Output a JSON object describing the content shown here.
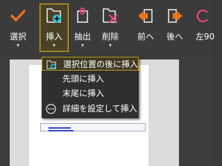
{
  "toolbar": {
    "items": [
      {
        "label": "選択",
        "icon": "checkmark-icon",
        "dropdown": true
      },
      {
        "label": "挿入",
        "icon": "insert-page-icon",
        "dropdown": true
      },
      {
        "label": "抽出",
        "icon": "extract-icon",
        "dropdown": true
      },
      {
        "label": "削除",
        "icon": "delete-page-icon",
        "dropdown": true
      },
      {
        "label": "前へ",
        "icon": "arrow-left-icon",
        "dropdown": false
      },
      {
        "label": "後へ",
        "icon": "arrow-right-icon",
        "dropdown": false
      },
      {
        "label": "左90",
        "icon": "rotate-left-icon",
        "dropdown": false
      }
    ],
    "caret": "▾"
  },
  "insert_menu": {
    "items": [
      {
        "label": "選択位置の後に挿入"
      },
      {
        "label": "先頭に挿入"
      },
      {
        "label": "末尾に挿入"
      },
      {
        "label": "詳細を設定して挿入"
      }
    ]
  },
  "colors": {
    "accent_orange": "#e8741e",
    "accent_pink": "#e0457b",
    "accent_cyan": "#2ec4c9",
    "highlight_gold": "#c9a227"
  }
}
